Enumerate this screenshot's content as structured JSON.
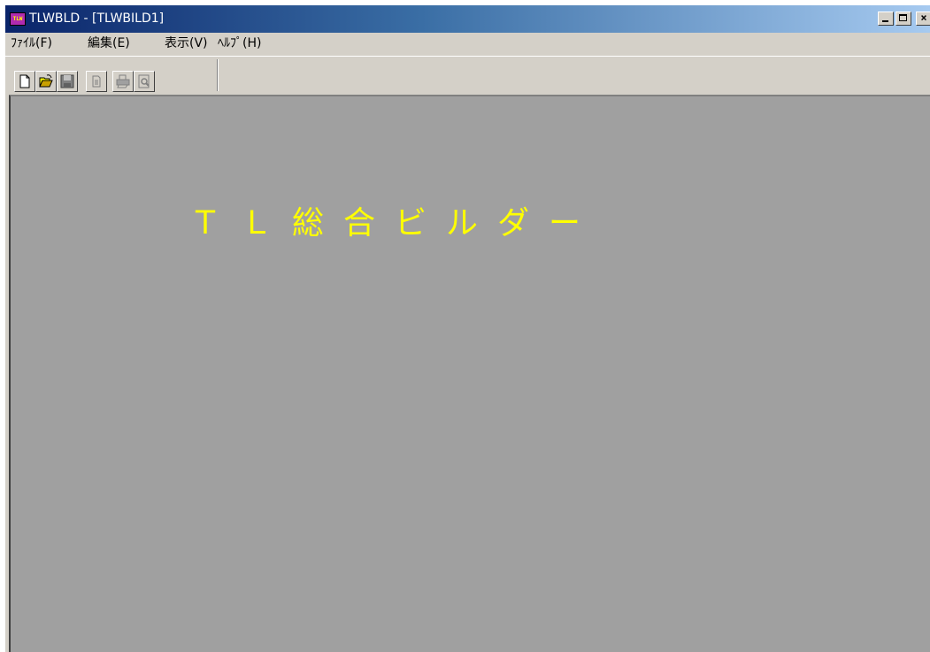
{
  "window": {
    "app_icon_label": "TLW",
    "title": "TLWBLD - [TLWBILD1]",
    "minimize_label": "_",
    "close_label": "×"
  },
  "menu": {
    "items": [
      {
        "label": "ﾌｧｲﾙ(F)"
      },
      {
        "label": "編集(E)"
      },
      {
        "label": "表示(V)"
      },
      {
        "label": "ﾍﾙﾌﾟ(H)"
      }
    ]
  },
  "toolbar": {
    "buttons": [
      {
        "icon": "new-file-icon",
        "enabled": true
      },
      {
        "icon": "open-folder-icon",
        "enabled": true
      },
      {
        "icon": "save-disk-icon",
        "enabled": false
      },
      {
        "icon": "copy-doc-icon",
        "enabled": false
      },
      {
        "icon": "print-icon",
        "enabled": false
      },
      {
        "icon": "print-preview-icon",
        "enabled": false
      }
    ]
  },
  "client": {
    "splash_text": "ＴＬ総合ビルダー",
    "background_color": "#a0a0a0",
    "splash_color": "#ffff00"
  }
}
